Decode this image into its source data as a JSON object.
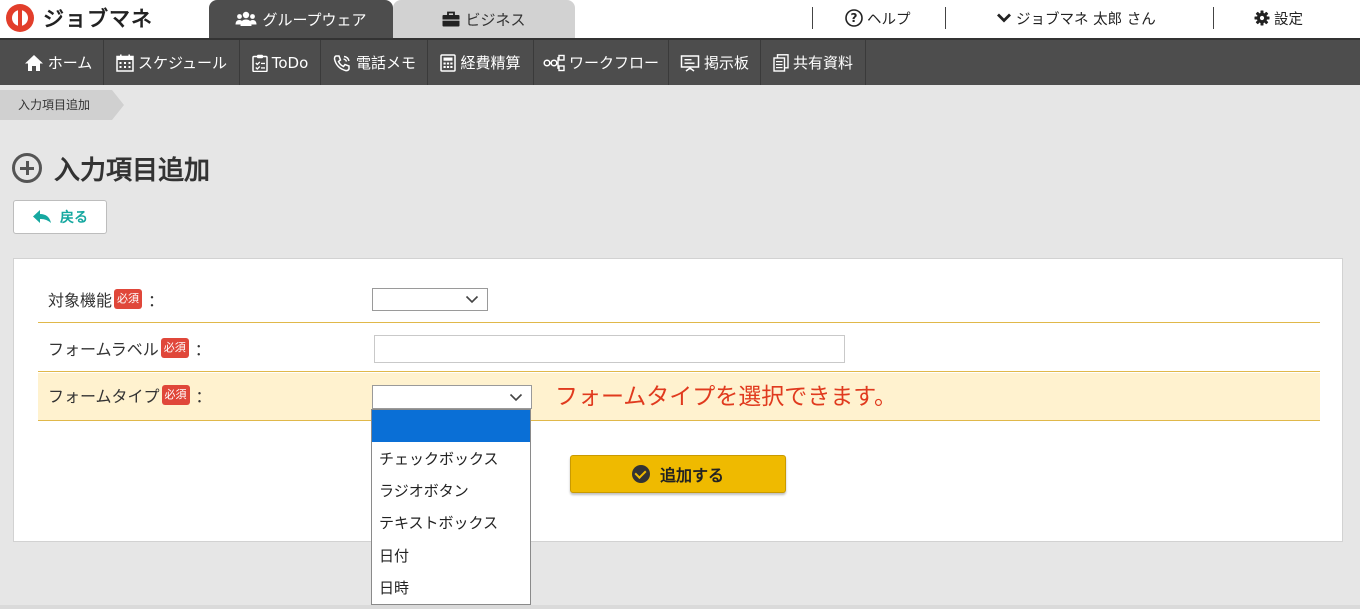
{
  "app": {
    "logo_text": "ジョブマネ"
  },
  "header": {
    "tabs": [
      {
        "label": "グループウェア",
        "icon": "users-icon",
        "active": true
      },
      {
        "label": "ビジネス",
        "icon": "briefcase-icon",
        "active": false
      }
    ],
    "help_label": "ヘルプ",
    "user_label": "ジョブマネ 太郎 さん",
    "settings_label": "設定"
  },
  "nav": {
    "items": [
      {
        "label": "ホーム",
        "icon": "home-icon"
      },
      {
        "label": "スケジュール",
        "icon": "calendar-icon"
      },
      {
        "label": "ToDo",
        "icon": "clipboard-icon"
      },
      {
        "label": "電話メモ",
        "icon": "phone-icon"
      },
      {
        "label": "経費精算",
        "icon": "calculator-icon"
      },
      {
        "label": "ワークフロー",
        "icon": "workflow-icon"
      },
      {
        "label": "掲示板",
        "icon": "board-icon"
      },
      {
        "label": "共有資料",
        "icon": "documents-icon"
      }
    ]
  },
  "breadcrumb": {
    "current": "入力項目追加"
  },
  "page": {
    "title": "入力項目追加",
    "back_label": "戻る"
  },
  "form": {
    "required_badge": "必須",
    "colon": "：",
    "fields": [
      {
        "label": "対象機能",
        "type": "select",
        "value": ""
      },
      {
        "label": "フォームラベル",
        "type": "text",
        "value": ""
      },
      {
        "label": "フォームタイプ",
        "type": "select",
        "value": ""
      }
    ],
    "hint": "フォームタイプを選択できます。",
    "submit_label": "追加する",
    "type_options": [
      "",
      "チェックボックス",
      "ラジオボタン",
      "テキストボックス",
      "日付",
      "日時"
    ]
  },
  "colors": {
    "nav_bg": "#4d4d4d",
    "accent_yellow": "#efba00",
    "required_red": "#e0473a",
    "hint_red": "#e03a1e",
    "back_teal": "#16a8a0",
    "highlight_row": "#fff2cf",
    "option_selected": "#0a6fd6"
  }
}
